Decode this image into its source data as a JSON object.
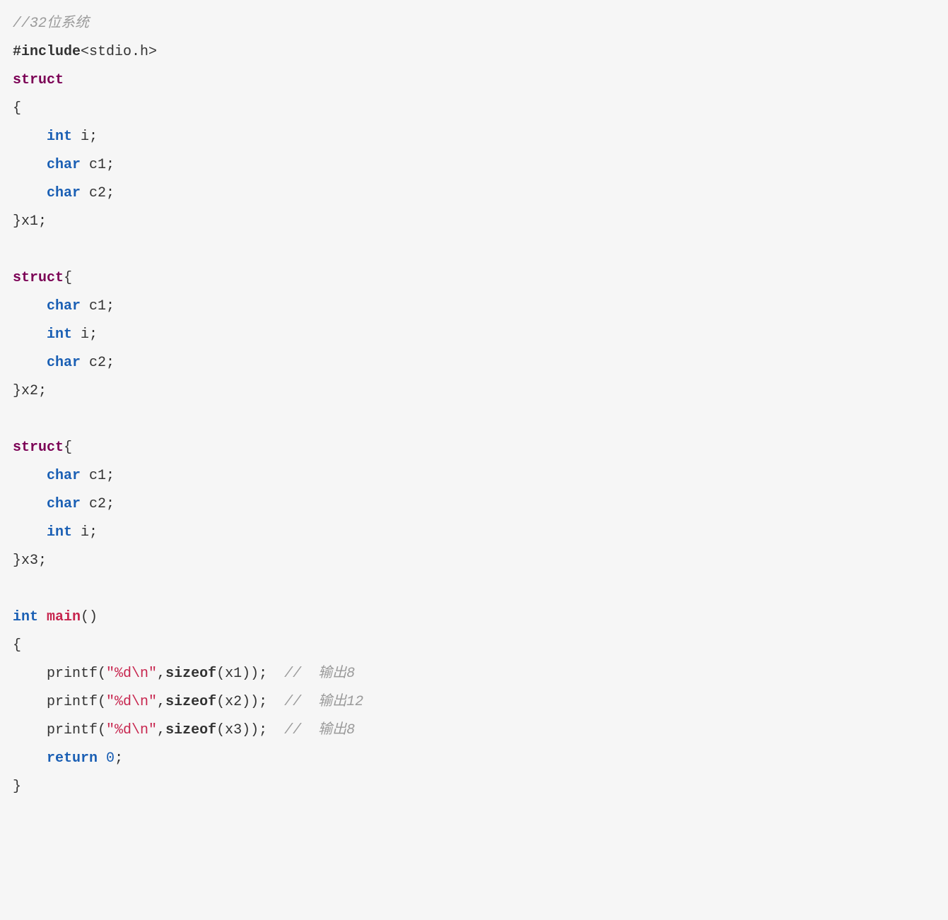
{
  "code": {
    "l01_comment": "//32位系统",
    "l02_include": "#include",
    "l02_header": "<stdio.h>",
    "l03_struct": "struct",
    "l04_open": "{",
    "l05_int": "int",
    "l05_id": " i;",
    "l06_char": "char",
    "l06_id": " c1;",
    "l07_char": "char",
    "l07_id": " c2;",
    "l08_close": "}x1;",
    "l10_struct": "struct",
    "l10_open": "{",
    "l11_char": "char",
    "l11_id": " c1;",
    "l12_int": "int",
    "l12_id": " i;",
    "l13_char": "char",
    "l13_id": " c2;",
    "l14_close": "}x2;",
    "l16_struct": "struct",
    "l16_open": "{",
    "l17_char": "char",
    "l17_id": " c1;",
    "l18_char": "char",
    "l18_id": " c2;",
    "l19_int": "int",
    "l19_id": " i;",
    "l20_close": "}x3;",
    "l22_int": "int",
    "l22_main": "main",
    "l22_parens": "()",
    "l23_open": "{",
    "l24_printf": "printf(",
    "l24_str": "\"%d\\n\"",
    "l24_mid": ",",
    "l24_sizeof": "sizeof",
    "l24_arg": "(x1));",
    "l24_sp": "  ",
    "l24_comment": "//  输出8",
    "l25_printf": "printf(",
    "l25_str": "\"%d\\n\"",
    "l25_mid": ",",
    "l25_sizeof": "sizeof",
    "l25_arg": "(x2));",
    "l25_sp": "  ",
    "l25_comment": "//  输出12",
    "l26_printf": "printf(",
    "l26_str": "\"%d\\n\"",
    "l26_mid": ",",
    "l26_sizeof": "sizeof",
    "l26_arg": "(x3));",
    "l26_sp": "  ",
    "l26_comment": "//  输出8",
    "l27_return": "return",
    "l27_sp": " ",
    "l27_zero": "0",
    "l27_semi": ";",
    "l28_close": "}",
    "indent": "    "
  }
}
